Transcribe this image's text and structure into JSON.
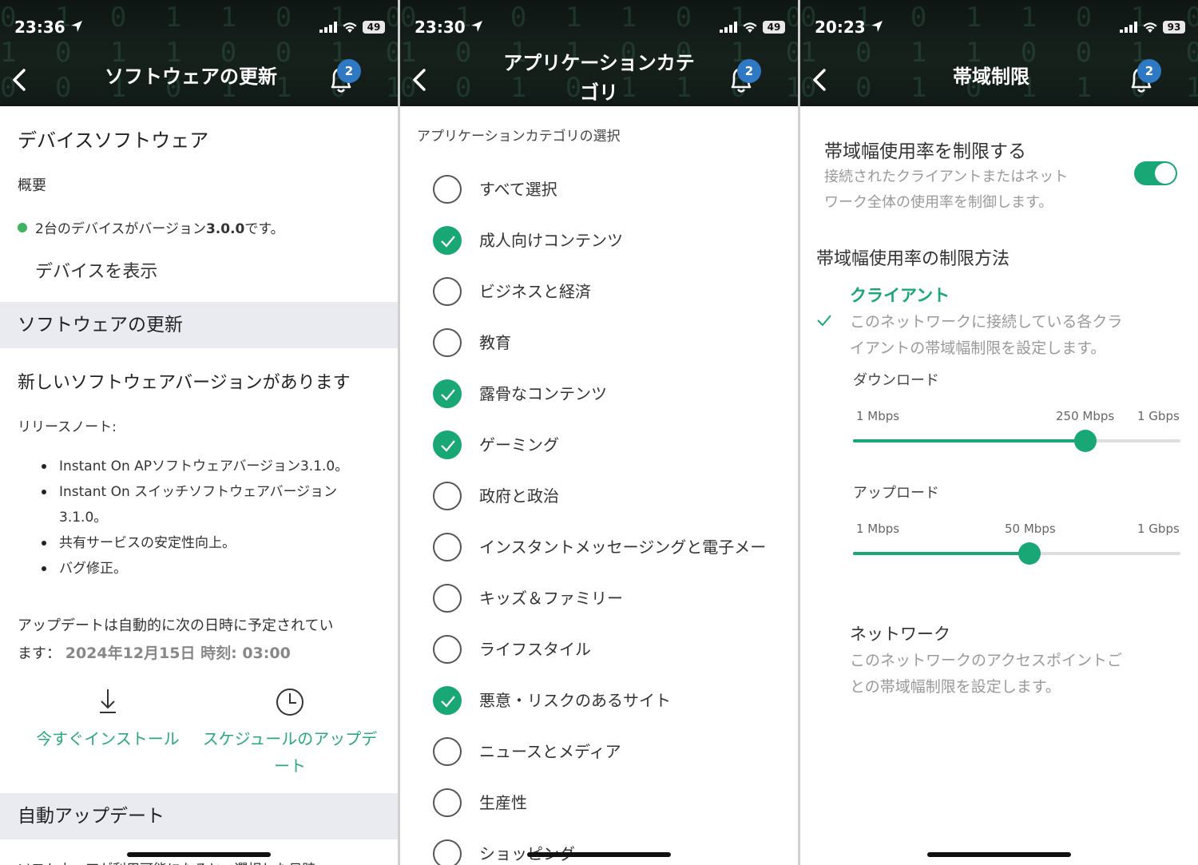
{
  "screen1": {
    "status": {
      "time": "23:36",
      "battery": "49"
    },
    "title": "ソフトウェアの更新",
    "badge": "2",
    "device_software_heading": "デバイスソフトウェア",
    "overview_label": "概要",
    "device_status": {
      "prefix": "2台のデバイスがバージョン",
      "version": "3.0.0",
      "suffix": "です。"
    },
    "view_devices_link": "デバイスを表示",
    "software_update_section": "ソフトウェアの更新",
    "new_version_heading": "新しいソフトウェアバージョンがあります",
    "release_notes_label": "リリースノート:",
    "release_notes": [
      "Instant On APソフトウェアバージョン3.1.0。",
      "Instant On スイッチソフトウェアバージョン 3.1.0。",
      "共有サービスの安定性向上。",
      "バグ修正。"
    ],
    "schedule_text_1": "アップデートは自動的に次の日時に予定されてい",
    "schedule_text_2": "ます：",
    "schedule_datetime": "2024年12月15日 時刻: 03:00",
    "install_now_label": "今すぐインストール",
    "schedule_update_label": "スケジュールのアップデート",
    "auto_update_section": "自動アップデート",
    "cut_off_text": "ソフトウェアが利用可能になると、選択した日時"
  },
  "screen2": {
    "status": {
      "time": "23:30",
      "battery": "49"
    },
    "title": "アプリケーションカテゴリ",
    "badge": "2",
    "subheader": "アプリケーションカテゴリの選択",
    "categories": [
      {
        "label": "すべて選択",
        "checked": false
      },
      {
        "label": "成人向けコンテンツ",
        "checked": true
      },
      {
        "label": "ビジネスと経済",
        "checked": false
      },
      {
        "label": "教育",
        "checked": false
      },
      {
        "label": "露骨なコンテンツ",
        "checked": true
      },
      {
        "label": "ゲーミング",
        "checked": true
      },
      {
        "label": "政府と政治",
        "checked": false
      },
      {
        "label": "インスタントメッセージングと電子メー",
        "checked": false
      },
      {
        "label": "キッズ＆ファミリー",
        "checked": false
      },
      {
        "label": "ライフスタイル",
        "checked": false
      },
      {
        "label": "悪意・リスクのあるサイト",
        "checked": true
      },
      {
        "label": "ニュースとメディア",
        "checked": false
      },
      {
        "label": "生産性",
        "checked": false
      },
      {
        "label": "ショッピング",
        "checked": false
      }
    ]
  },
  "screen3": {
    "status": {
      "time": "20:23",
      "battery": "93"
    },
    "title": "帯域制限",
    "badge": "2",
    "limit_heading": "帯域幅使用率を制限する",
    "limit_desc_1": "接続されたクライアントまたはネット",
    "limit_desc_2": "ワーク全体の使用率を制御します。",
    "limit_enabled": true,
    "method_heading": "帯域幅使用率の制限方法",
    "client_title": "クライアント",
    "client_desc_1": "このネットワークに接続している各クラ",
    "client_desc_2": "イアントの帯域幅制限を設定します。",
    "download": {
      "label": "ダウンロード",
      "min": "1 Mbps",
      "value": "250 Mbps",
      "max": "1 Gbps",
      "level": 0.71
    },
    "upload": {
      "label": "アップロード",
      "min": "1 Mbps",
      "value": "50 Mbps",
      "max": "1 Gbps",
      "level": 0.54
    },
    "network_title": "ネットワーク",
    "network_desc_1": "このネットワークのアクセスポイントご",
    "network_desc_2": "との帯域幅制限を設定します。"
  },
  "colors": {
    "accent": "#1aa776",
    "link_blue": "#2f7cc4",
    "badge_blue": "#2f78c4",
    "section_bg": "#e9ebf0",
    "status_green": "#3cb55e"
  }
}
